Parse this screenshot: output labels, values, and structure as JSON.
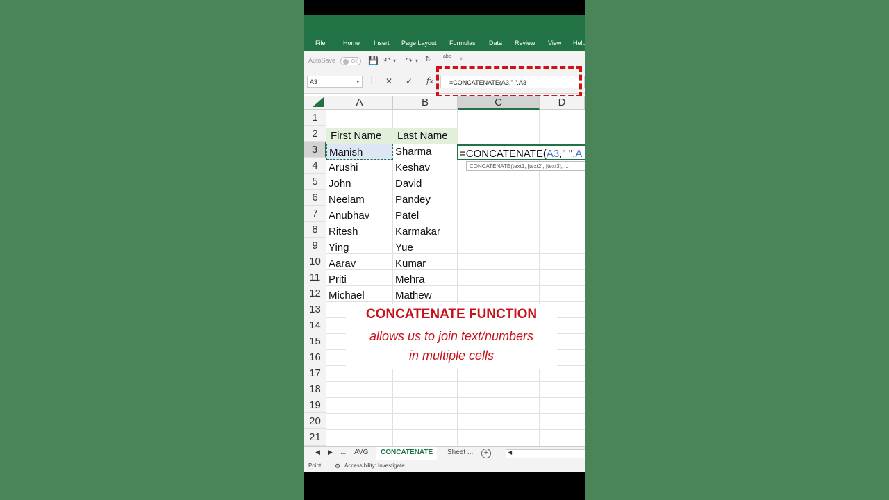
{
  "ribbon": {
    "tabs": [
      "File",
      "Home",
      "Insert",
      "Page Layout",
      "Formulas",
      "Data",
      "Review",
      "View",
      "Help"
    ]
  },
  "qat": {
    "autosave_label": "AutoSave",
    "autosave_state": "Off"
  },
  "formula_bar": {
    "name_box": "A3",
    "fx_label": "fx",
    "formula": "=CONCATENATE(A3,\" \",A3"
  },
  "grid": {
    "columns": [
      "A",
      "B",
      "C",
      "D"
    ],
    "selected_column": "C",
    "rows": [
      "1",
      "2",
      "3",
      "4",
      "5",
      "6",
      "7",
      "8",
      "9",
      "10",
      "11",
      "12",
      "13",
      "14",
      "15",
      "16",
      "17",
      "18",
      "19",
      "20",
      "21"
    ],
    "selected_row": "3",
    "headers": {
      "first_name": "First Name",
      "last_name": "Last Name"
    },
    "data": [
      [
        "Manish",
        "Sharma"
      ],
      [
        "Arushi",
        "Keshav"
      ],
      [
        "John",
        "David"
      ],
      [
        "Neelam",
        "Pandey"
      ],
      [
        "Anubhav",
        "Patel"
      ],
      [
        "Ritesh",
        "Karmakar"
      ],
      [
        "Ying",
        "Yue"
      ],
      [
        "Aarav",
        "Kumar"
      ],
      [
        "Priti",
        "Mehra"
      ],
      [
        "Michael",
        "Mathew"
      ]
    ],
    "active_cell_text": {
      "prefix": "=CONCATENATE(",
      "ref1": "A3",
      "middle": ",\" \",",
      "ref2": "A"
    },
    "tooltip": "CONCATENATE(text1, [text2], [text3], ..."
  },
  "overlay": {
    "title": "CONCATENATE FUNCTION",
    "line1": "allows us to join text/numbers",
    "line2": "in multiple cells"
  },
  "sheet_tabs": {
    "ellipsis": "...",
    "tabs": [
      "AVG",
      "CONCATENATE",
      "Sheet ..."
    ],
    "active": "CONCATENATE",
    "add_label": "+"
  },
  "status": {
    "mode": "Point",
    "accessibility": "Accessibility: Investigate"
  },
  "colors": {
    "excel_green": "#217346",
    "highlight_red": "#d0111a",
    "background": "#4a8459"
  }
}
